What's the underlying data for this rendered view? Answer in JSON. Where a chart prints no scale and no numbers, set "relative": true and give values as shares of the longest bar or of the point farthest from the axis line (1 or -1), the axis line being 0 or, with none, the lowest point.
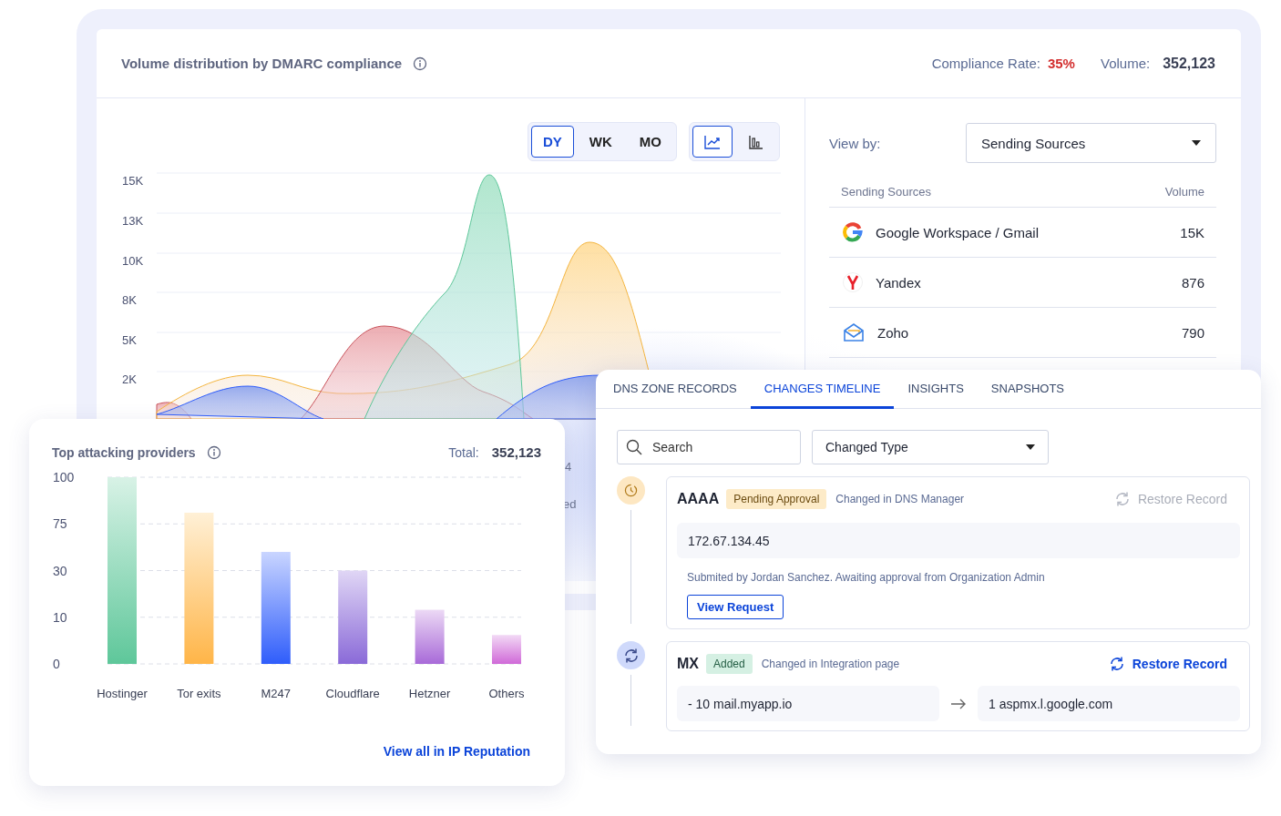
{
  "overview": {
    "title": "Volume distribution by DMARC compliance",
    "compliance_label": "Compliance Rate:",
    "compliance_value": "35%",
    "volume_label": "Volume:",
    "volume_value": "352,123",
    "periods": [
      {
        "label": "DY",
        "selected": true
      },
      {
        "label": "WK",
        "selected": false
      },
      {
        "label": "MO",
        "selected": false
      }
    ],
    "chart_types": [
      {
        "kind": "line",
        "selected": true
      },
      {
        "kind": "bar",
        "selected": false
      }
    ],
    "y_axis_labels": [
      "15K",
      "13K",
      "10K",
      "8K",
      "5K",
      "2K"
    ],
    "hidden_fragments": [
      "4",
      "ed"
    ],
    "view_by": {
      "label": "View by:",
      "value": "Sending Sources"
    },
    "sources": {
      "columns": [
        "Sending Sources",
        "Volume"
      ],
      "rows": [
        {
          "name": "Google Workspace / Gmail",
          "volume": "15K"
        },
        {
          "name": "Yandex",
          "volume": "876"
        },
        {
          "name": "Zoho",
          "volume": "790"
        }
      ]
    }
  },
  "attackers": {
    "title": "Top attacking providers",
    "total_label": "Total:",
    "total_value": "352,123",
    "chart_data": {
      "type": "bar",
      "categories": [
        "Hostinger",
        "Tor exits",
        "M247",
        "Cloudflare",
        "Hetzner",
        "Others"
      ],
      "values": [
        1,
        0.81,
        0.6,
        0.5,
        0.29,
        0.155
      ],
      "relative": true
    },
    "y_axis_labels": [
      "100",
      "75",
      "30",
      "10",
      "0"
    ],
    "link": "View all in IP Reputation"
  },
  "dns": {
    "tabs": [
      {
        "label": "DNS ZONE RECORDS",
        "selected": false
      },
      {
        "label": "CHANGES TIMELINE",
        "selected": true
      },
      {
        "label": "INSIGHTS",
        "selected": false
      },
      {
        "label": "SNAPSHOTS",
        "selected": false
      }
    ],
    "search": {
      "placeholder": "Search"
    },
    "filter": {
      "value": "Changed Type"
    },
    "entries": [
      {
        "record": "AAAA",
        "status": {
          "label": "Pending Approval",
          "kind": "pending"
        },
        "source": "Changed in DNS Manager",
        "restore": {
          "label": "Restore Record",
          "disabled": true
        },
        "value": "172.67.134.45",
        "note": "Submited by Jordan Sanchez. Awaiting approval from Organization Admin",
        "action": "View Request"
      },
      {
        "record": "MX",
        "status": {
          "label": "Added",
          "kind": "added"
        },
        "source": "Changed in Integration page",
        "restore": {
          "label": "Restore Record",
          "disabled": false
        },
        "from": "- 10 mail.myapp.io",
        "to": "1 aspmx.l.google.com"
      }
    ]
  }
}
